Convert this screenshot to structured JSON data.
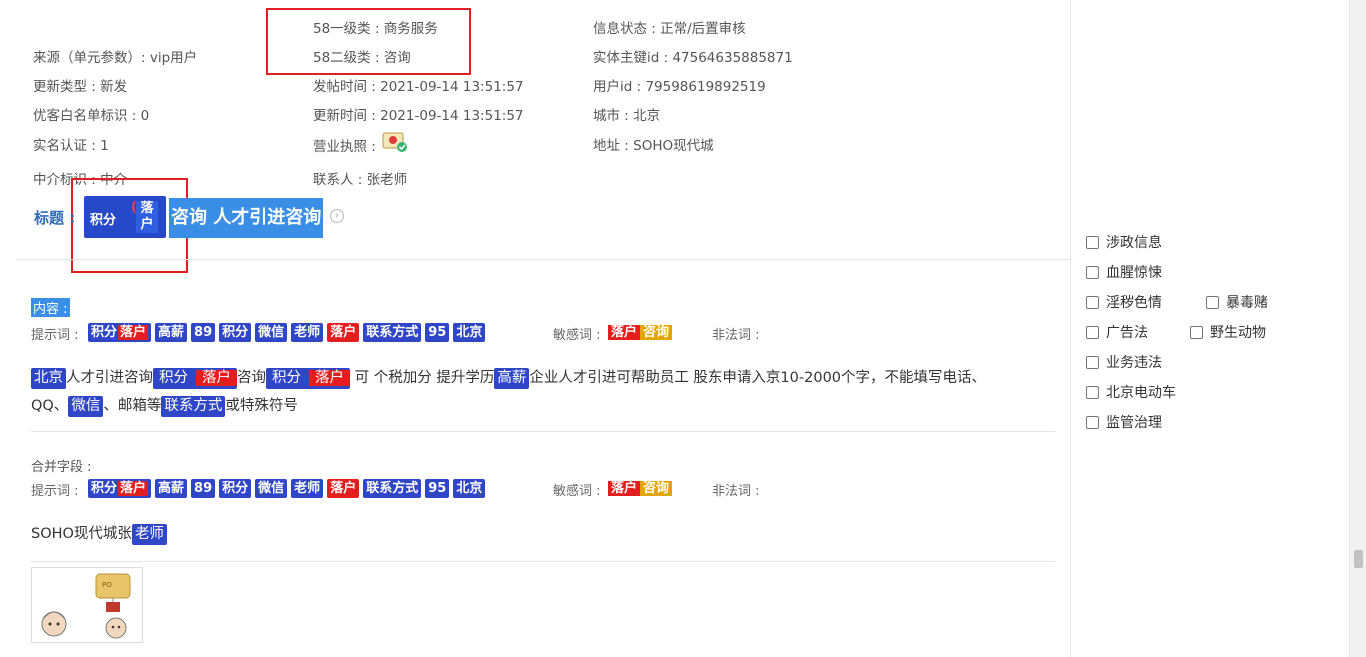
{
  "info": {
    "level1": "58一级类 : 商务服务",
    "level2": "58二级类 : 咨询",
    "info_status": "信息状态 : 正常/后置审核",
    "source": "来源（单元参数）: vip用户",
    "entity_key": "实体主键id : 47564635885871",
    "update_type": "更新类型 : 新发",
    "post_time": "发帖时间 : 2021-09-14 13:51:57",
    "user_id": "用户id : 79598619892519",
    "whitelist": "优客白名单标识 : 0",
    "update_time": "更新时间 : 2021-09-14 13:51:57",
    "city": "城市 : 北京",
    "realname": "实名认证 : 1",
    "license": "营业执照 :",
    "address": "地址 : SOHO现代城",
    "agent": "中介标识 : 中介",
    "contact": "联系人 : 张老师"
  },
  "title": {
    "label": "标题 :",
    "tag_jf": "积分",
    "paren": "(",
    "tag_lh": "落户",
    "rest": "咨询 人才引进咨询",
    "arrow_icon": "chevron-right-circle-icon"
  },
  "content": {
    "section_label": "内容 :",
    "hint_label": "提示词 :",
    "sensitive_label": "敏感词 :",
    "illegal_label": "非法词 :",
    "hint_tags": [
      "积分",
      "高薪",
      "89",
      "积分",
      "微信",
      "老师",
      "落户",
      "联系方式",
      "95",
      "北京"
    ],
    "hint_tag0_red": "落户",
    "sensitive_a": "落户",
    "sensitive_b": "咨询",
    "body": {
      "t_beijing": "北京",
      "s1": "人才引进咨询",
      "t_jf": "积分",
      "t_lh": "落户",
      "s2": "咨询",
      "t_jf2": "积分",
      "t_lh2": "落户",
      "s3": "可 个税加分 提升学历",
      "t_gx": "高薪",
      "s4": "企业人才引进可帮助员工 股东申请入京10-2000个字，不能填写电话、",
      "s5": "QQ、",
      "t_wx": "微信",
      "s6": "、邮箱等",
      "t_lxfs": "联系方式",
      "s7": "或特殊符号"
    }
  },
  "merge": {
    "section_label": "合并字段 :",
    "hint_label": "提示词 :",
    "sensitive_label": "敏感词 :",
    "illegal_label": "非法词 :",
    "hint_tags": [
      "积分",
      "高薪",
      "89",
      "积分",
      "微信",
      "老师",
      "落户",
      "联系方式",
      "95",
      "北京"
    ],
    "hint_tag0_red": "落户",
    "sensitive_a": "落户",
    "sensitive_b": "咨询",
    "text": "SOHO现代城张",
    "text_tag": "老师"
  },
  "sidebar": {
    "checkboxes": [
      "涉政信息",
      "血腥惊悚",
      "淫秽色情",
      "暴毒赌",
      "广告法",
      "野生动物",
      "业务违法",
      "北京电动车",
      "监管治理"
    ]
  },
  "colors": {
    "tag_blue": "#2f47c6",
    "tag_red": "#e41e1e",
    "sens_yellow": "#e6a400",
    "title_blue": "#3a8ee6",
    "highlight_box": "#e02020"
  }
}
